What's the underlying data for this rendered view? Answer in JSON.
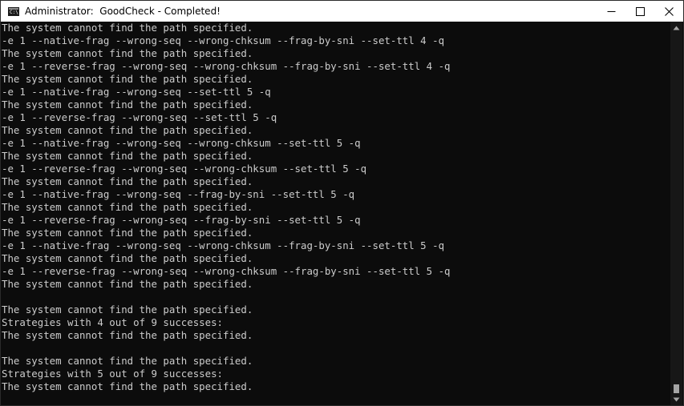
{
  "window": {
    "title": "Administrator:  GoodCheck - Completed!",
    "app_icon": "cmd-console-icon",
    "icon_glyph": "C:\\"
  },
  "controls": {
    "minimize_icon": "minimize-icon",
    "maximize_icon": "maximize-icon",
    "close_icon": "close-icon"
  },
  "console": {
    "lines": [
      "The system cannot find the path specified.",
      "-e 1 --native-frag --wrong-seq --wrong-chksum --frag-by-sni --set-ttl 4 -q",
      "The system cannot find the path specified.",
      "-e 1 --reverse-frag --wrong-seq --wrong-chksum --frag-by-sni --set-ttl 4 -q",
      "The system cannot find the path specified.",
      "-e 1 --native-frag --wrong-seq --set-ttl 5 -q",
      "The system cannot find the path specified.",
      "-e 1 --reverse-frag --wrong-seq --set-ttl 5 -q",
      "The system cannot find the path specified.",
      "-e 1 --native-frag --wrong-seq --wrong-chksum --set-ttl 5 -q",
      "The system cannot find the path specified.",
      "-e 1 --reverse-frag --wrong-seq --wrong-chksum --set-ttl 5 -q",
      "The system cannot find the path specified.",
      "-e 1 --native-frag --wrong-seq --frag-by-sni --set-ttl 5 -q",
      "The system cannot find the path specified.",
      "-e 1 --reverse-frag --wrong-seq --frag-by-sni --set-ttl 5 -q",
      "The system cannot find the path specified.",
      "-e 1 --native-frag --wrong-seq --wrong-chksum --frag-by-sni --set-ttl 5 -q",
      "The system cannot find the path specified.",
      "-e 1 --reverse-frag --wrong-seq --wrong-chksum --frag-by-sni --set-ttl 5 -q",
      "The system cannot find the path specified.",
      "",
      "The system cannot find the path specified.",
      "Strategies with 4 out of 9 successes:",
      "The system cannot find the path specified.",
      "",
      "The system cannot find the path specified.",
      "Strategies with 5 out of 9 successes:",
      "The system cannot find the path specified."
    ]
  },
  "scrollbar": {
    "up_icon": "scroll-up-arrow-icon",
    "down_icon": "scroll-down-arrow-icon",
    "position": 0.97
  }
}
